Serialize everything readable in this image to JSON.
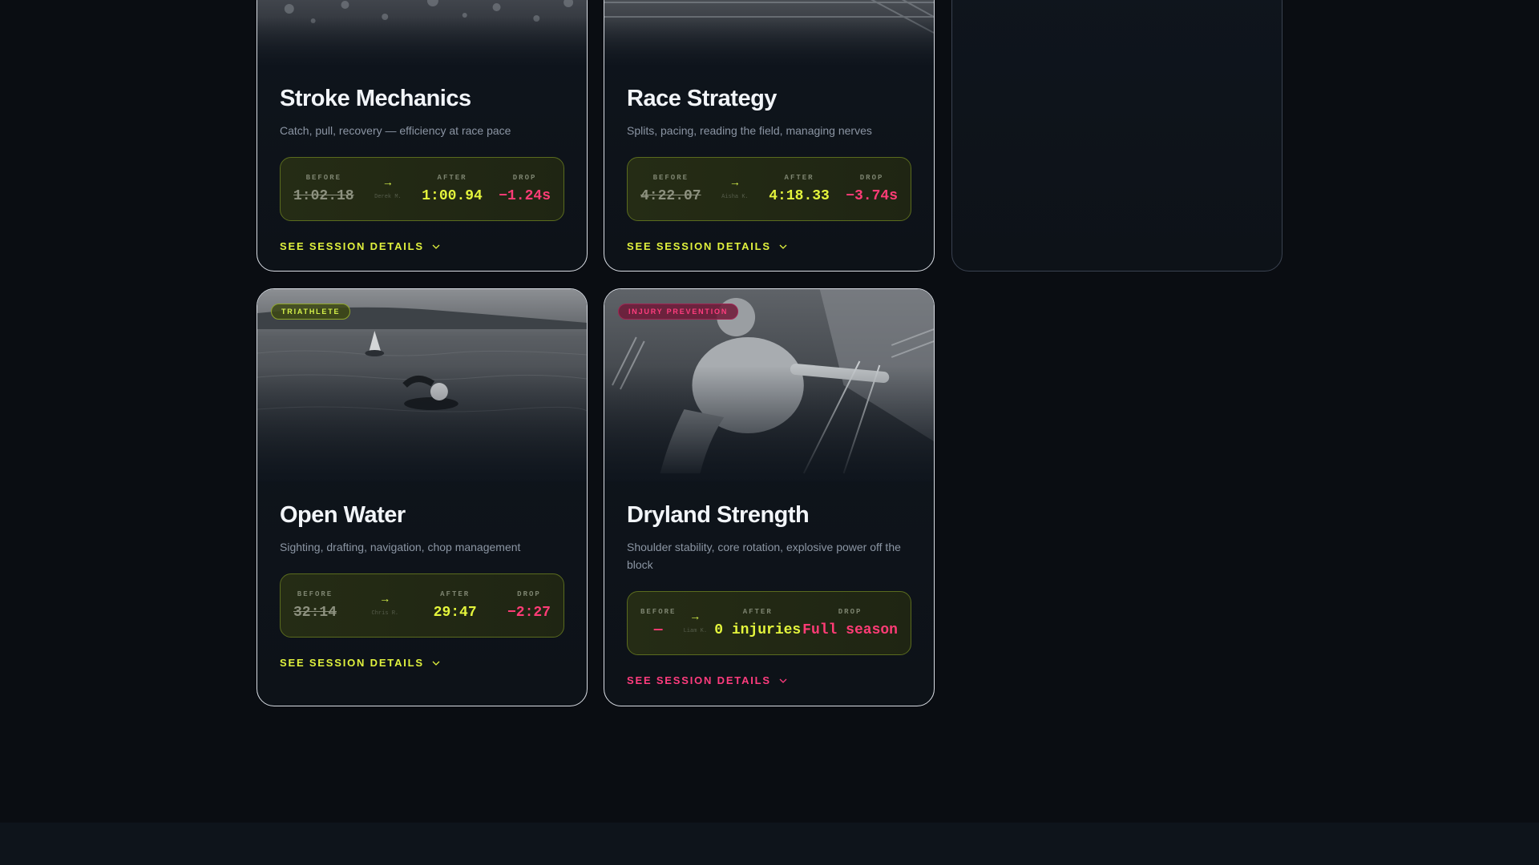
{
  "cards": [
    {
      "title": "Stroke Mechanics",
      "desc": "Catch, pull, recovery — efficiency at race pace",
      "stats": {
        "before_label": "BEFORE",
        "before": "1:02.18",
        "coach": "Derek M.",
        "after_label": "AFTER",
        "after": "1:00.94",
        "drop_label": "DROP",
        "drop": "−1.24s"
      },
      "details_label": "SEE SESSION DETAILS"
    },
    {
      "title": "Race Strategy",
      "desc": "Splits, pacing, reading the field, managing nerves",
      "stats": {
        "before_label": "BEFORE",
        "before": "4:22.07",
        "coach": "Aisha K.",
        "after_label": "AFTER",
        "after": "4:18.33",
        "drop_label": "DROP",
        "drop": "−3.74s"
      },
      "details_label": "SEE SESSION DETAILS"
    },
    {
      "tag": "TRIATHLETE",
      "title": "Open Water",
      "desc": "Sighting, drafting, navigation, chop management",
      "stats": {
        "before_label": "BEFORE",
        "before": "32:14",
        "coach": "Chris R.",
        "after_label": "AFTER",
        "after": "29:47",
        "drop_label": "DROP",
        "drop": "−2:27"
      },
      "details_label": "SEE SESSION DETAILS"
    },
    {
      "tag": "INJURY PREVENTION",
      "title": "Dryland Strength",
      "desc": "Shoulder stability, core rotation, explosive power off the block",
      "stats": {
        "before_label": "BEFORE",
        "before": "—",
        "coach": "Liam K.",
        "after_label": "AFTER",
        "after": "0 injuries",
        "drop_label": "DROP",
        "drop": "Full season"
      },
      "details_label": "SEE SESSION DETAILS"
    }
  ],
  "colors": {
    "accent_lime": "#e1f23d",
    "accent_pink": "#ff3c7e",
    "background": "#0a0d12"
  }
}
